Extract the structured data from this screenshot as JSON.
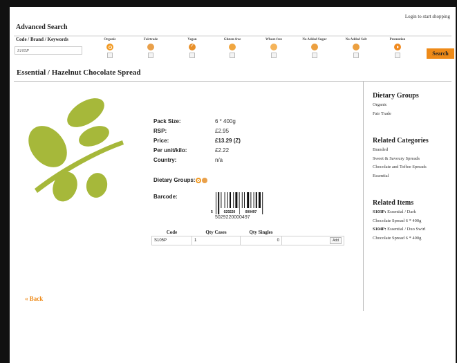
{
  "header": {
    "login_link": "Login to start shopping",
    "title": "Advanced Search"
  },
  "search": {
    "keyword_label": "Code / Brand / Keywords",
    "keyword_value": "S105P",
    "filters": [
      {
        "label": "Organic",
        "icon": "organic-icon"
      },
      {
        "label": "Fairtrade",
        "icon": "fairtrade-icon"
      },
      {
        "label": "Vegan",
        "icon": "vegan-icon"
      },
      {
        "label": "Gluten-free",
        "icon": "gluten-free-icon"
      },
      {
        "label": "Wheat-free",
        "icon": "wheat-free-icon"
      },
      {
        "label": "No Added Sugar",
        "icon": "no-added-sugar-icon"
      },
      {
        "label": "No Added Salt",
        "icon": "no-added-salt-icon"
      },
      {
        "label": "Promotion",
        "icon": "promotion-icon"
      }
    ],
    "button_label": "Search",
    "accent_color": "#ee8a18"
  },
  "product": {
    "title": "Essential / Hazelnut Chocolate Spread",
    "leaf_color": "#a6b83a",
    "details": [
      {
        "label": "Pack Size:",
        "value": "6 * 400g"
      },
      {
        "label": "RSP:",
        "value": "£2.95"
      },
      {
        "label": "Price:",
        "value": "£13.29 (Z)"
      },
      {
        "label": "Per unit/kilo:",
        "value": "£2.22"
      },
      {
        "label": "Country:",
        "value": "n/a"
      }
    ],
    "dietary_groups_label": "Dietary Groups:",
    "barcode_label": "Barcode:",
    "barcode_digits": {
      "first": "5",
      "left": "029220",
      "right": "000497"
    },
    "barcode_number": "5029220000497",
    "table": {
      "headers": [
        "Code",
        "Qty Cases",
        "Qty Singles"
      ],
      "row": {
        "code": "S105P",
        "qty_cases": "1",
        "qty_singles": "0",
        "add_label": "Add"
      }
    }
  },
  "back_label": "« Back",
  "sidebar": {
    "dietary": {
      "title": "Dietary Groups",
      "items": [
        "Organic",
        "Fair Trade"
      ]
    },
    "categories": {
      "title": "Related Categories",
      "items": [
        "Branded",
        "Sweet & Savoury Spreads",
        "Chocolate and Toffee Spreads",
        "Essential"
      ]
    },
    "related": {
      "title": "Related Items",
      "items": [
        {
          "code": "S103P:",
          "lines": [
            "Essential / Dark",
            "Chocolate Spread 6 * 400g"
          ]
        },
        {
          "code": "S104P:",
          "lines": [
            "Essential / Duo Swirl",
            "Chocolate Spread 6 * 400g"
          ]
        }
      ]
    }
  }
}
